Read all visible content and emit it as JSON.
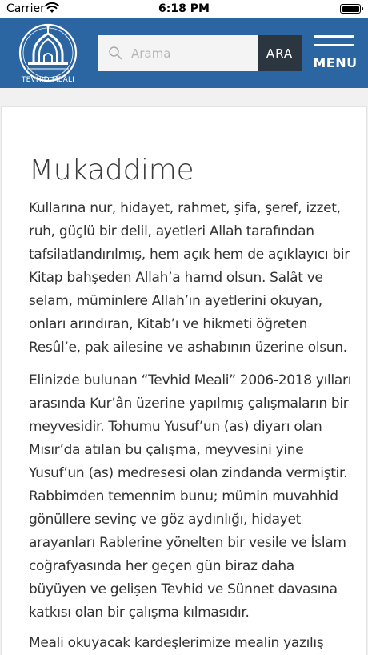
{
  "status_bar": {
    "carrier": "Carrier",
    "time": "6:18 PM"
  },
  "header": {
    "logo_text": "TEVHID MEALI",
    "search": {
      "placeholder": "Arama",
      "value": "",
      "button_label": "ARA"
    },
    "menu_label": "MENU"
  },
  "article": {
    "title": "Mukaddime",
    "paragraphs": [
      [
        "Kullarına nur, hidayet, rahmet, şifa, şeref, izzet,",
        "ruh, güçlü bir delil, ayetleri Allah tarafından",
        "tafsilatlandırılmış, hem açık hem de açıklayıcı bir",
        "Kitap bahşeden Allah’a hamd olsun. Salât ve",
        "selam, müminlere Allah’ın ayetlerini okuyan,",
        "onları arındıran, Kitab’ı ve hikmeti öğreten",
        "Resûl’e, pak ailesine ve ashabının üzerine olsun."
      ],
      [
        "Elinizde bulunan “Tevhid Meali” 2006-2018 yılları",
        "arasında Kur’ân üzerine yapılmış çalışmaların bir",
        "meyvesidir. Tohumu Yusuf’un (as) diyarı olan",
        "Mısır’da atılan bu çalışma, meyvesini yine",
        "Yusuf’un (as) medresesi olan zindanda vermiştir.",
        "Rabbimden temennim bunu; mümin muvahhid",
        "gönüllere sevinç ve göz aydınlığı, hidayet",
        "arayanları Rablerine yönelten bir vesile ve İslam",
        "coğrafyasında her geçen gün biraz daha",
        "büyüyen ve gelişen Tevhid ve Sünnet davasına",
        "katkısı olan bir çalışma kılmasıdır."
      ],
      [
        "Meali okuyacak kardeşlerimize mealin yazılış"
      ]
    ]
  },
  "colors": {
    "header_bg": "#2b66a3",
    "search_button_bg": "#2b3640",
    "page_bg": "#f1f1f1"
  },
  "icons": {
    "wifi": "wifi-icon",
    "battery": "battery-icon",
    "search": "search-icon",
    "menu": "hamburger-menu-icon",
    "logo": "mosque-dome-logo"
  }
}
